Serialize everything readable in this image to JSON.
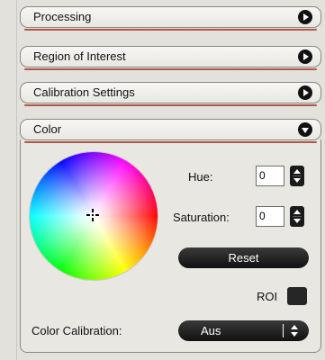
{
  "sections": [
    {
      "label": "Processing",
      "state": "collapsed"
    },
    {
      "label": "Region of Interest",
      "state": "collapsed"
    },
    {
      "label": "Calibration Settings",
      "state": "collapsed"
    },
    {
      "label": "Color",
      "state": "expanded"
    }
  ],
  "color": {
    "hue_label": "Hue:",
    "hue_value": "0",
    "saturation_label": "Saturation:",
    "saturation_value": "0",
    "reset_label": "Reset",
    "roi_label": "ROI",
    "roi_checked": false,
    "calibration_label": "Color Calibration:",
    "calibration_value": "Aus"
  },
  "icons": {
    "collapsed": "circle-right-arrow-icon",
    "expanded": "circle-down-arrow-icon",
    "stepper": "up-down-stepper-icon",
    "picker": "crosshair-icon"
  },
  "colors": {
    "accent_underline": "#b0564a",
    "button_dark": "#111111"
  }
}
